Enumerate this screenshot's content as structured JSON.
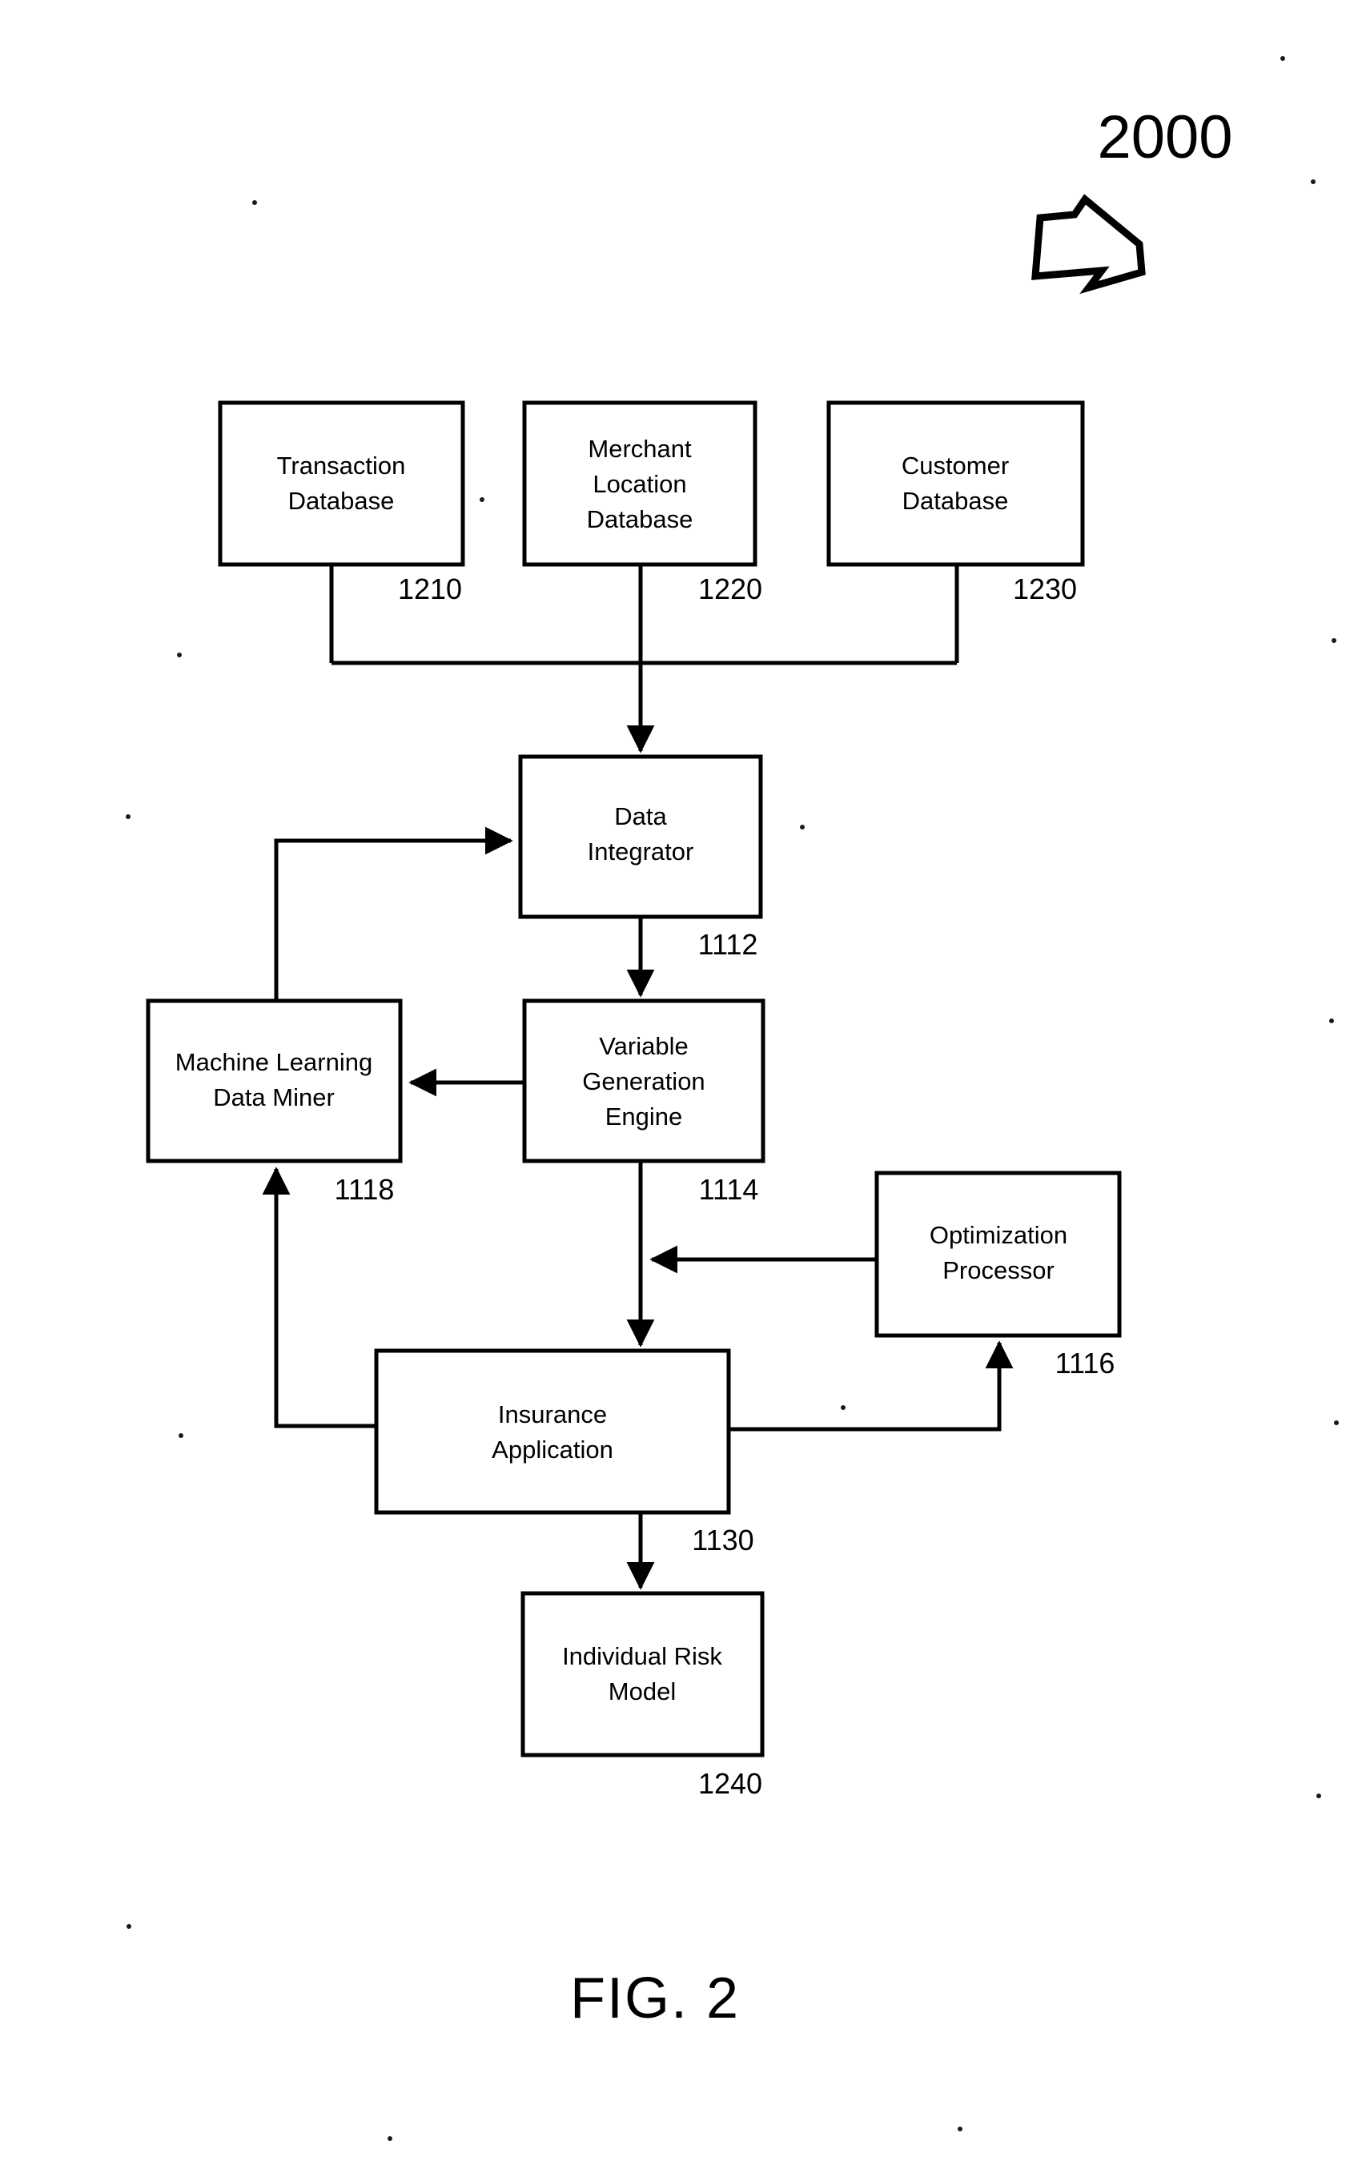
{
  "figure": {
    "diagram_number": "2000",
    "caption": "FIG. 2",
    "pointer_icon": "block-arrow-down-left-icon"
  },
  "boxes": [
    {
      "id": "transaction-database",
      "label_lines": [
        "Transaction",
        "Database"
      ],
      "ref": "1210"
    },
    {
      "id": "merchant-location-database",
      "label_lines": [
        "Merchant",
        "Location",
        "Database"
      ],
      "ref": "1220"
    },
    {
      "id": "customer-database",
      "label_lines": [
        "Customer",
        "Database"
      ],
      "ref": "1230"
    },
    {
      "id": "data-integrator",
      "label_lines": [
        "Data",
        "Integrator"
      ],
      "ref": "1112"
    },
    {
      "id": "machine-learning-data-miner",
      "label_lines": [
        "Machine Learning",
        "Data Miner"
      ],
      "ref": "1118"
    },
    {
      "id": "variable-generation-engine",
      "label_lines": [
        "Variable",
        "Generation",
        "Engine"
      ],
      "ref": "1114"
    },
    {
      "id": "optimization-processor",
      "label_lines": [
        "Optimization",
        "Processor"
      ],
      "ref": "1116"
    },
    {
      "id": "insurance-application",
      "label_lines": [
        "Insurance",
        "Application"
      ],
      "ref": "1130"
    },
    {
      "id": "individual-risk-model",
      "label_lines": [
        "Individual Risk",
        "Model"
      ],
      "ref": "1240"
    }
  ],
  "box_text": {
    "transaction_database": {
      "line1": "Transaction",
      "line2": "Database"
    },
    "merchant_location_database": {
      "line1": "Merchant",
      "line2": "Location",
      "line3": "Database"
    },
    "customer_database": {
      "line1": "Customer",
      "line2": "Database"
    },
    "data_integrator": {
      "line1": "Data",
      "line2": "Integrator"
    },
    "machine_learning_data_miner": {
      "line1": "Machine Learning",
      "line2": "Data Miner"
    },
    "variable_generation_engine": {
      "line1": "Variable",
      "line2": "Generation",
      "line3": "Engine"
    },
    "optimization_processor": {
      "line1": "Optimization",
      "line2": "Processor"
    },
    "insurance_application": {
      "line1": "Insurance",
      "line2": "Application"
    },
    "individual_risk_model": {
      "line1": "Individual Risk",
      "line2": "Model"
    }
  },
  "ref_numbers": {
    "transaction_database": "1210",
    "merchant_location_database": "1220",
    "customer_database": "1230",
    "data_integrator": "1112",
    "machine_learning_data_miner": "1118",
    "variable_generation_engine": "1114",
    "optimization_processor": "1116",
    "insurance_application": "1130",
    "individual_risk_model": "1240"
  },
  "connections": [
    {
      "id": "transaction-db-to-bus",
      "from": "transaction-database",
      "to": "data-bus",
      "arrow": false
    },
    {
      "id": "merchant-db-to-data-integrator",
      "from": "merchant-location-database",
      "to": "data-integrator",
      "arrow": true
    },
    {
      "id": "customer-db-to-bus",
      "from": "customer-database",
      "to": "data-bus",
      "arrow": false
    },
    {
      "id": "data-integrator-to-variable-engine",
      "from": "data-integrator",
      "to": "variable-generation-engine",
      "arrow": true
    },
    {
      "id": "variable-engine-to-data-miner",
      "from": "variable-generation-engine",
      "to": "machine-learning-data-miner",
      "arrow": true
    },
    {
      "id": "data-miner-to-data-integrator",
      "from": "machine-learning-data-miner",
      "to": "data-integrator",
      "arrow": true
    },
    {
      "id": "variable-engine-to-insurance-app",
      "from": "variable-generation-engine",
      "to": "insurance-application",
      "arrow": true
    },
    {
      "id": "optimization-processor-to-pipeline",
      "from": "optimization-processor",
      "to": "variable-engine-output-line",
      "arrow": true
    },
    {
      "id": "insurance-app-to-optimization",
      "from": "insurance-application",
      "to": "optimization-processor",
      "arrow": true
    },
    {
      "id": "insurance-app-to-data-miner",
      "from": "insurance-application",
      "to": "machine-learning-data-miner",
      "arrow": true
    },
    {
      "id": "insurance-app-to-risk-model",
      "from": "insurance-application",
      "to": "individual-risk-model",
      "arrow": true
    }
  ]
}
